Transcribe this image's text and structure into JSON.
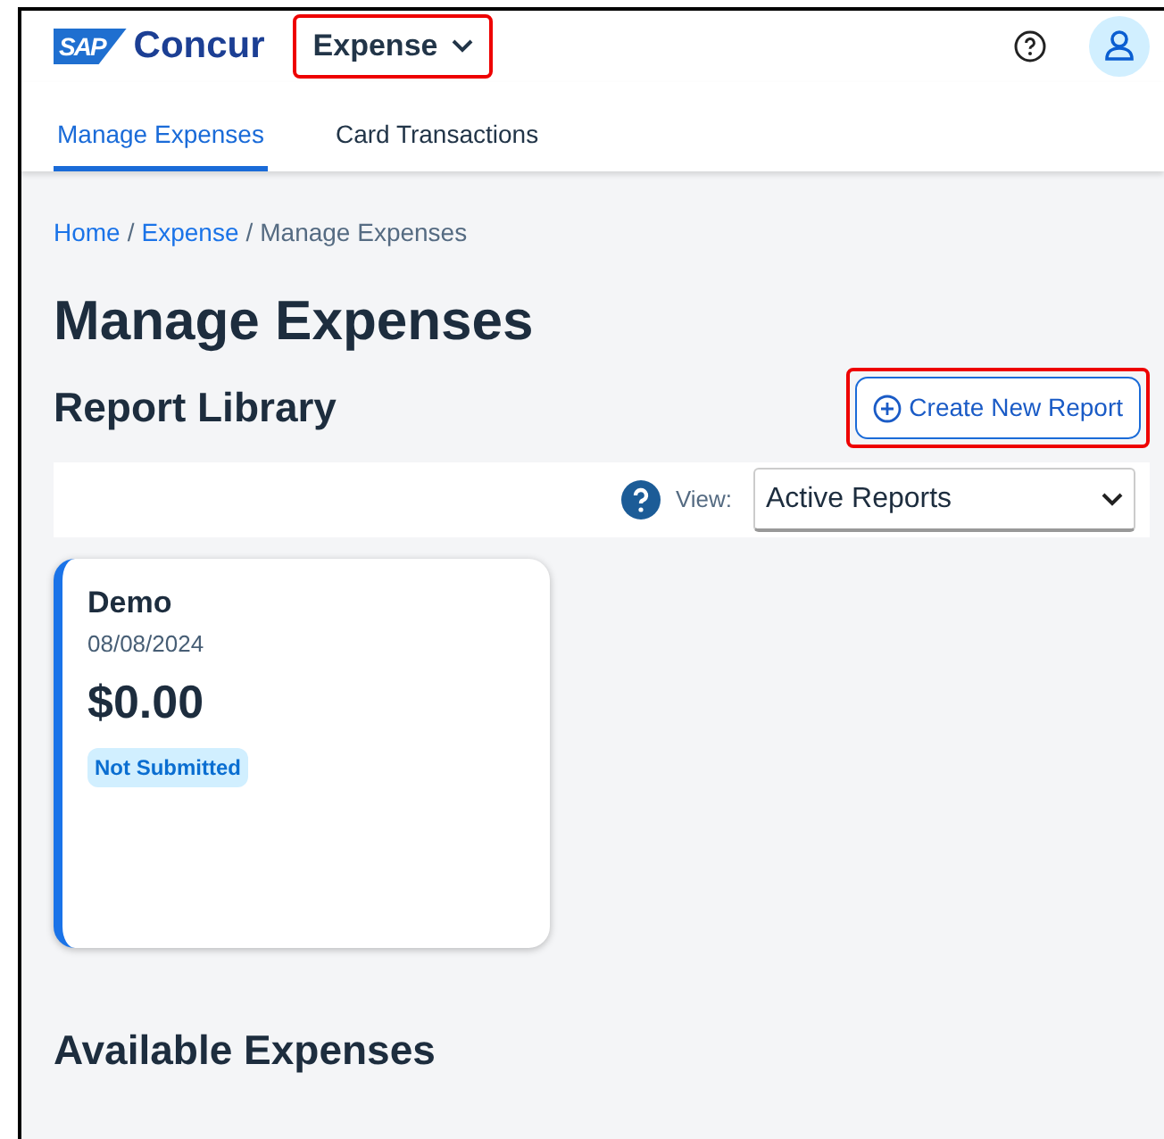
{
  "header": {
    "logo": {
      "mark": "SAP",
      "name": "Concur"
    },
    "product_menu": {
      "label": "Expense",
      "highlighted": true
    }
  },
  "tabs": [
    {
      "label": "Manage Expenses",
      "selected": true
    },
    {
      "label": "Card Transactions",
      "selected": false
    }
  ],
  "breadcrumb": [
    {
      "label": "Home",
      "kind": "link"
    },
    {
      "label": "/",
      "kind": "separator"
    },
    {
      "label": "Expense",
      "kind": "link"
    },
    {
      "label": "/",
      "kind": "separator"
    },
    {
      "label": "Manage Expenses",
      "kind": "current"
    }
  ],
  "title": "Manage Expenses",
  "report_library": {
    "heading": "Report Library",
    "create_button": {
      "label": "Create New Report",
      "highlighted": true
    },
    "view_label": "View:",
    "view_value": "Active Reports"
  },
  "reports": [
    {
      "name": "Demo",
      "date": "08/08/2024",
      "amount": "$0.00",
      "status": "Not Submitted"
    }
  ],
  "available_heading": "Available Expenses"
}
